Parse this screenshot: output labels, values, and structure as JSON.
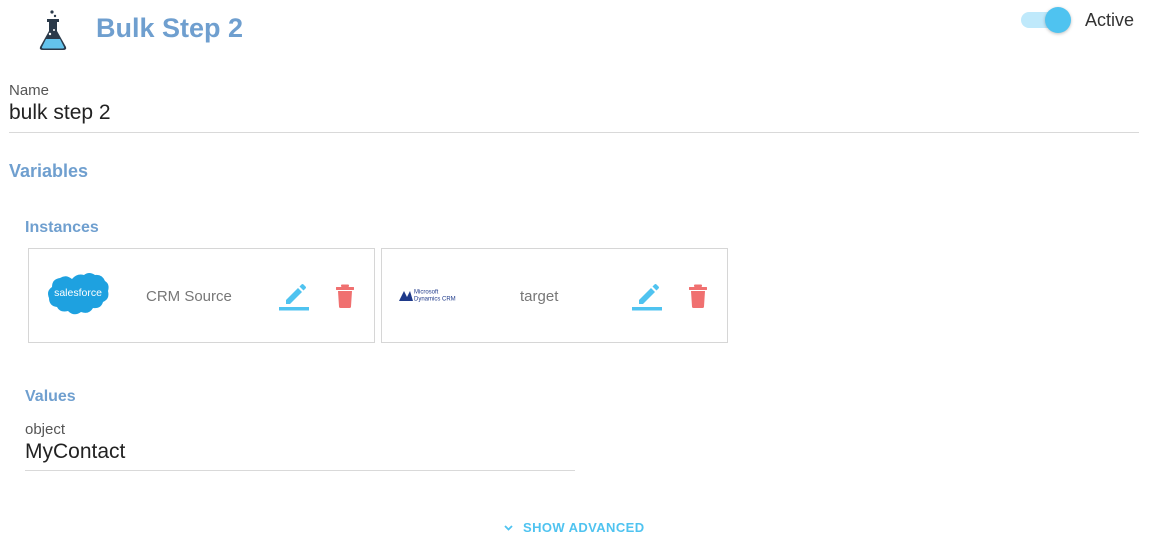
{
  "header": {
    "title": "Bulk Step 2",
    "icon": "flask-icon",
    "active_label": "Active",
    "active": true
  },
  "name_field": {
    "label": "Name",
    "value": "bulk step 2"
  },
  "sections": {
    "variables": "Variables",
    "instances": "Instances",
    "values": "Values"
  },
  "instances": [
    {
      "logo": "salesforce-logo",
      "logo_text": "salesforce",
      "name": "CRM Source",
      "edit_icon": "edit-icon",
      "delete_icon": "trash-icon"
    },
    {
      "logo": "microsoft-dynamics-logo",
      "logo_text_line1": "Microsoft",
      "logo_text_line2": "Dynamics CRM",
      "name": "target",
      "edit_icon": "edit-icon",
      "delete_icon": "trash-icon"
    }
  ],
  "values": {
    "object_label": "object",
    "object_value": "MyContact"
  },
  "show_advanced": "SHOW ADVANCED",
  "colors": {
    "title_blue": "#6f9fcf",
    "accent_cyan": "#4fc3f0",
    "delete_red": "#f07070",
    "salesforce_blue": "#1ea1e0"
  }
}
